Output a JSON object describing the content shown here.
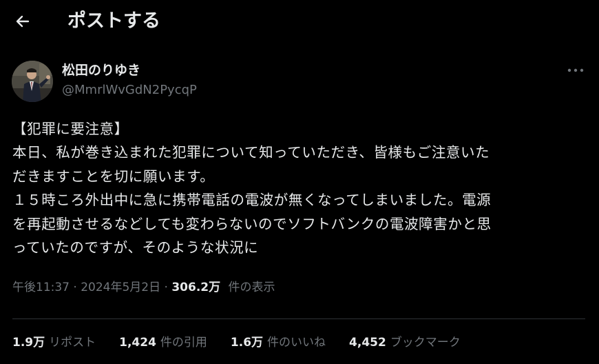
{
  "header": {
    "title": "ポストする",
    "back_icon": "arrow-left-icon"
  },
  "author": {
    "name": "松田のりゆき",
    "handle": "@MmrlWvGdN2PycqP"
  },
  "tweet": {
    "lines": [
      "【犯罪に要注意】",
      "本日、私が巻き込まれた犯罪について知っていただき、皆様もご注意いた",
      "だきますことを切に願います。",
      "１５時ころ外出中に急に携帯電話の電波が無くなってしまいました。電源",
      "を再起動させるなどしても変わらないのでソフトバンクの電波障害かと思",
      "っていたのですが、そのような状況に"
    ]
  },
  "meta": {
    "time": "午後11:37",
    "separator": "·",
    "date": "2024年5月2日",
    "views_count": "306.2万",
    "views_label": "件の表示"
  },
  "stats": [
    {
      "count": "1.9万",
      "label": "リポスト"
    },
    {
      "count": "1,424",
      "label": "件の引用"
    },
    {
      "count": "1.6万",
      "label": "件のいいね"
    },
    {
      "count": "4,452",
      "label": "ブックマーク"
    }
  ],
  "colors": {
    "background": "#000000",
    "text_primary": "#e7e9ea",
    "text_secondary": "#71767b",
    "divider": "#2f3336"
  }
}
